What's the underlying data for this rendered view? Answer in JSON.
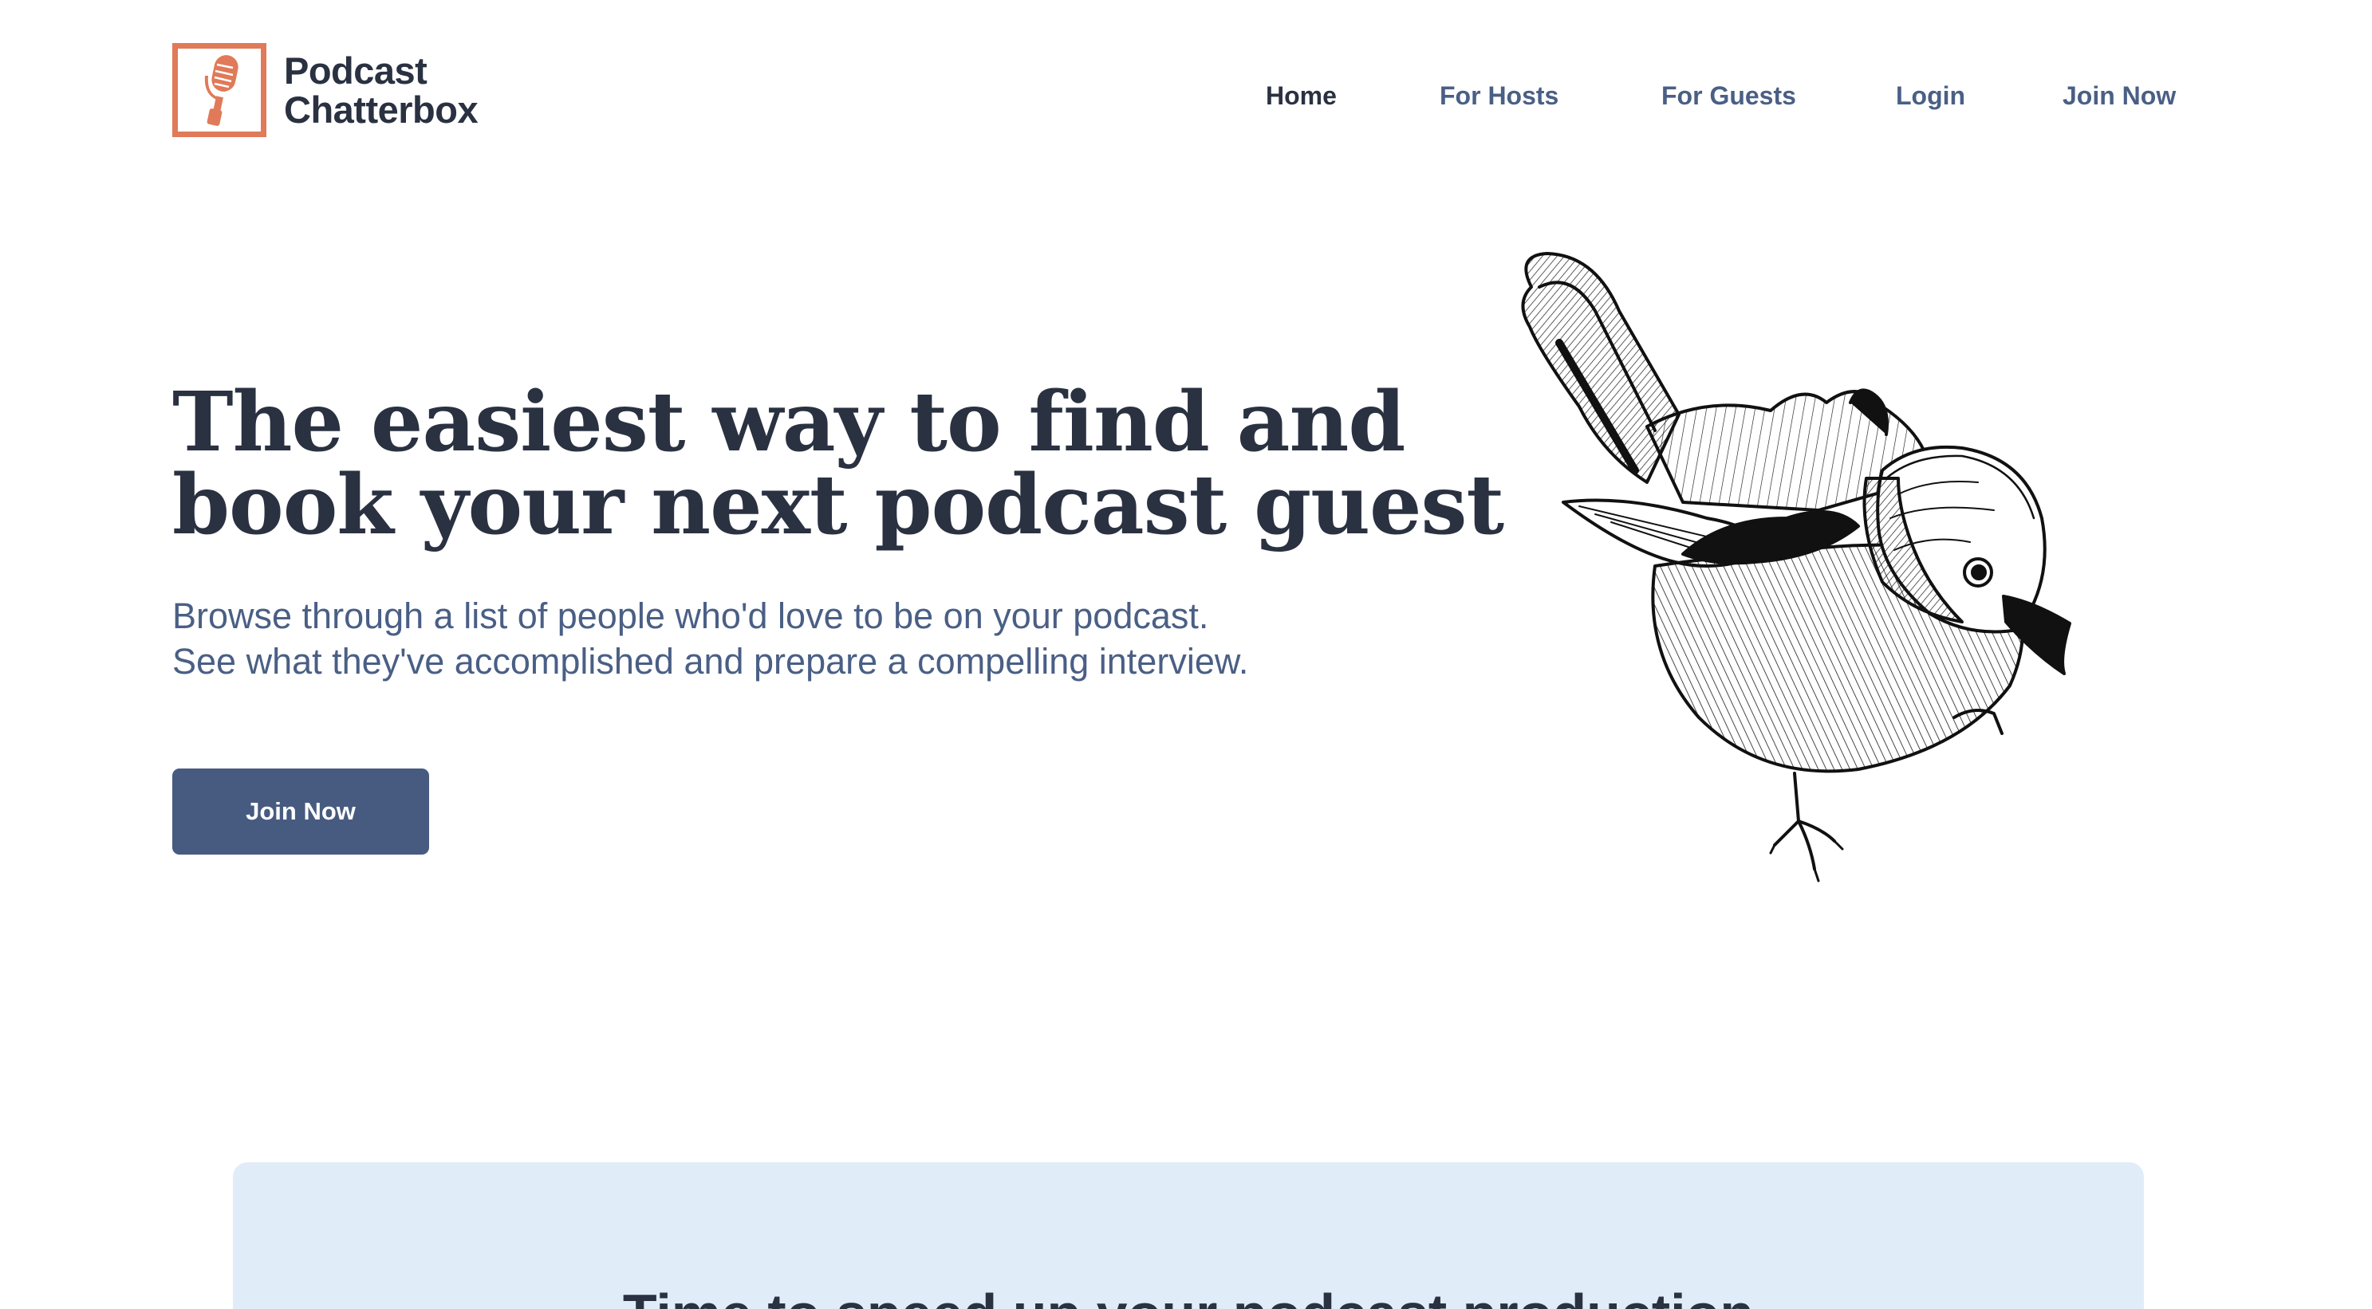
{
  "brand": {
    "line1": "Podcast",
    "line2": "Chatterbox",
    "icon": "microphone-icon",
    "accent_color": "#e07a59"
  },
  "nav": {
    "items": [
      {
        "label": "Home",
        "active": true
      },
      {
        "label": "For Hosts",
        "active": false
      },
      {
        "label": "For Guests",
        "active": false
      },
      {
        "label": "Login",
        "active": false
      },
      {
        "label": "Join Now",
        "active": false
      }
    ]
  },
  "hero": {
    "title_line1": "The easiest way to find and",
    "title_line2": "book your next podcast guest",
    "subtitle_line1": "Browse through a list of people who'd love to be on your podcast.",
    "subtitle_line2": "See what they've accomplished and prepare a compelling interview.",
    "cta_label": "Join Now",
    "illustration": "bird-illustration"
  },
  "feature_panel": {
    "title": "Time to speed up your podcast production"
  },
  "colors": {
    "heading": "#2a3141",
    "body_text": "#4a5f85",
    "button": "#475b80",
    "panel_bg": "#e0edf8"
  }
}
